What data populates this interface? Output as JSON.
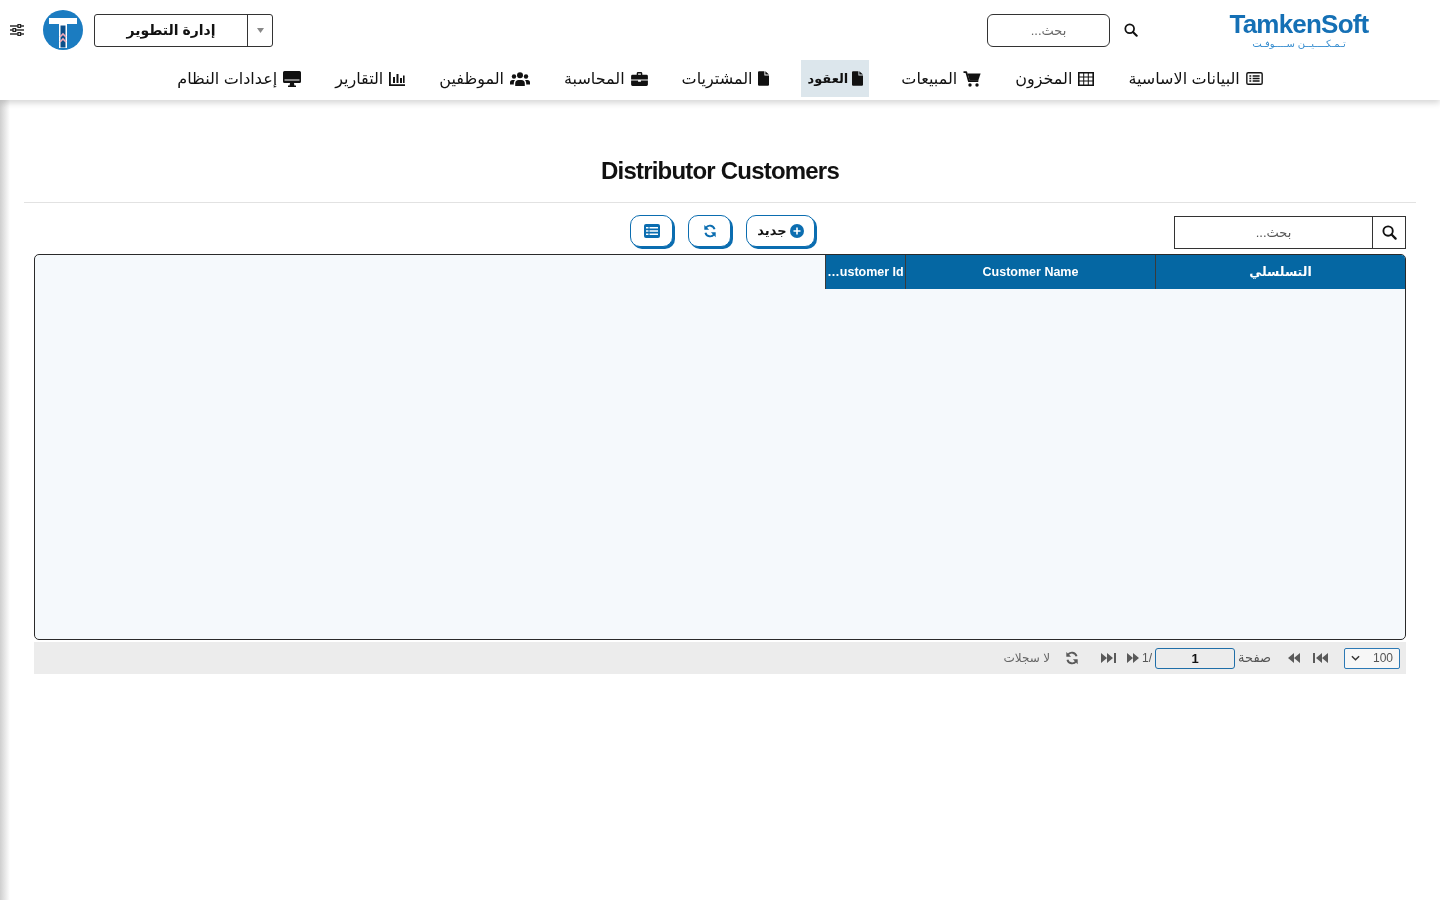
{
  "header": {
    "logo": {
      "wordmark": "TamkenSoft",
      "tagline": "تـمـكــــيــن ســــوفـت"
    },
    "search": {
      "placeholder": "بحث..."
    },
    "department_select": {
      "value": "إدارة التطوير"
    }
  },
  "nav": [
    {
      "label": "البيانات الاساسية",
      "selected": false
    },
    {
      "label": "المخزون",
      "selected": false
    },
    {
      "label": "المبيعات",
      "selected": false
    },
    {
      "label": "العقود",
      "selected": true
    },
    {
      "label": "المشتريات",
      "selected": false
    },
    {
      "label": "المحاسبة",
      "selected": false
    },
    {
      "label": "الموظفين",
      "selected": false
    },
    {
      "label": "التقارير",
      "selected": false
    },
    {
      "label": "إعدادات النظام",
      "selected": false
    }
  ],
  "page": {
    "title": "Distributor Customers"
  },
  "toolbar": {
    "search": {
      "placeholder": "بحث..."
    },
    "new_button": "جديد"
  },
  "table": {
    "columns": [
      "التسلسلي",
      "Customer Name",
      "…ustomer Id"
    ]
  },
  "pager": {
    "page_size": "100",
    "page_label": "صفحة",
    "page": "1",
    "page_count": "1/",
    "status": "لا سجلات"
  }
}
